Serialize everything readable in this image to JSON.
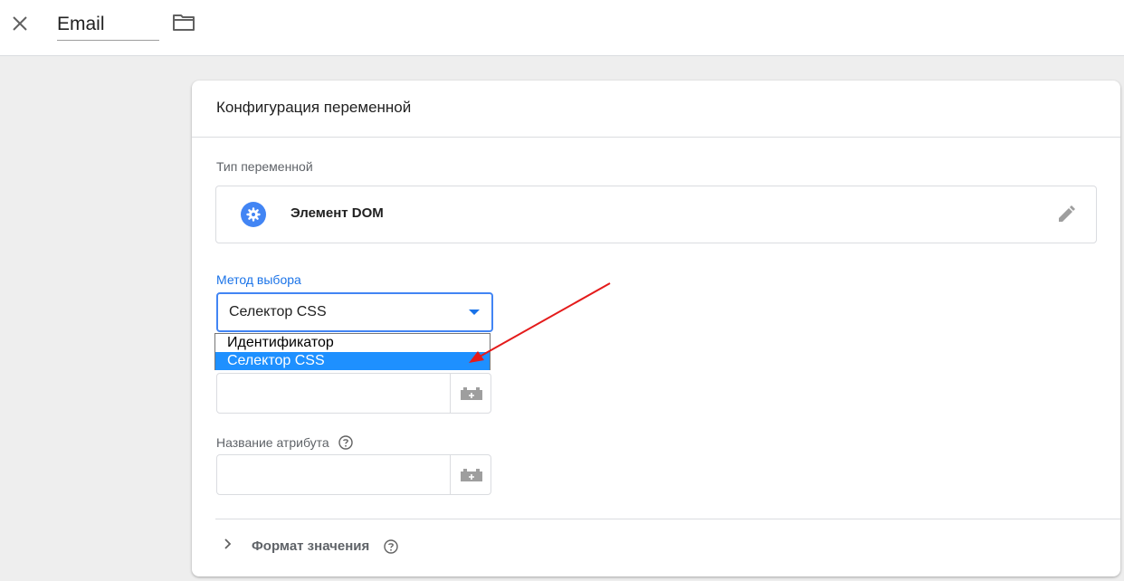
{
  "header": {
    "variable_name": "Email"
  },
  "card": {
    "title": "Конфигурация переменной",
    "type_label": "Тип переменной",
    "type_name": "Элемент DOM",
    "method_label": "Метод выбора",
    "method_selected": "Селектор CSS",
    "method_options": [
      "Идентификатор",
      "Селектор CSS"
    ],
    "attribute_label": "Название атрибута",
    "format_label": "Формат значения"
  },
  "colors": {
    "accent": "#4285f4",
    "link_blue": "#1a73e8",
    "highlight": "#1e90ff",
    "annotation_arrow": "#e41b1b"
  },
  "icons": [
    "close-icon",
    "folder-icon",
    "gear-icon",
    "pencil-icon",
    "variable-block-icon",
    "help-icon",
    "chevron-right-icon",
    "arrow-annotation"
  ]
}
